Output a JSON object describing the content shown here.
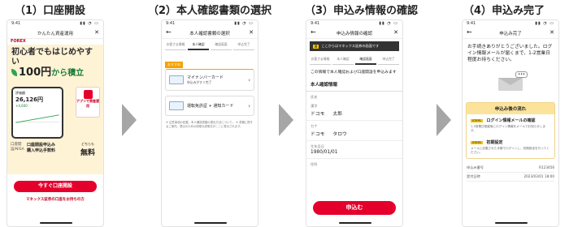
{
  "steps": [
    {
      "title": "（1）口座開設"
    },
    {
      "title": "（2）本人確認書類の選択"
    },
    {
      "title": "（3）申込み情報の確認"
    },
    {
      "title": "（4）申込み完了"
    }
  ],
  "phone1": {
    "status_time": "9:41",
    "status_icons": "▮▮ ◔ ▭",
    "nav_title": "かんたん資産運用",
    "brand": "FOREX",
    "headline1": "初心者でもはじめやすい",
    "amount": "100円",
    "headline2_suffix": "から積立",
    "mock_label": "評価額",
    "mock_amount": "26,126円",
    "mock_gain": "+4,600",
    "app_badge": "アプリで資産運用",
    "row_left": "口座開設/NISA",
    "row_mid1": "口座開設申込み",
    "row_mid2": "購入申込手数料",
    "row_right_label": "どちらも",
    "row_right_value": "無料",
    "cta": "今すぐ口座開設",
    "link": "マネックス証券の口座をお持ちの方"
  },
  "phone2": {
    "status_time": "9:41",
    "status_icons": "▮▮ ◔ ▭",
    "nav_title": "本人確認書類の選択",
    "tabs": [
      "お客さま情報",
      "本人確認",
      "確認画面",
      "申込完了"
    ],
    "rec_tag": "おすすめ",
    "option1": "マイナンバーカード",
    "option1_sub": "申込みがすぐ完了",
    "option2": "運転免許証 + 通知カード",
    "notes": "※ 注意事項の記載。本人確認書類の提出方法について。 ※ 書類に関するご案内。提出のための詳細な説明文がここに表示されます。"
  },
  "phone3": {
    "status_time": "9:41",
    "status_icons": "▮▮ ◔ ▭",
    "nav_title": "申込み情報の確認",
    "alert_mark": "X",
    "alert": "ここからはマネックス証券の画面です",
    "tabs": [
      "お客さま情報",
      "本人確認",
      "確認画面",
      "申込完了"
    ],
    "message": "この情報で本人確認および口座開設を申込みます",
    "section_title": "本人確認情報",
    "fields": [
      {
        "label": "氏名",
        "value1": "",
        "value2": ""
      },
      {
        "label": "漢字",
        "value1": "ドコモ",
        "value2": "太郎"
      },
      {
        "label": "カナ",
        "value1": "ドコモ",
        "value2": "タロウ"
      },
      {
        "label": "生年月日",
        "value1": "1980/01/01",
        "value2": ""
      },
      {
        "label": "住所",
        "value1": "",
        "value2": ""
      }
    ],
    "submit": "申込む"
  },
  "phone4": {
    "status_time": "9:41",
    "status_icons": "▮▮ ◔ ▭",
    "nav_title": "申込み完了",
    "thanks": "お手続きありがとうございました。ログイン情報メールが届くまで、1-2営業日程度お待ちください。",
    "bubble": "•••",
    "flow_title": "申込み後の流れ",
    "steps": [
      {
        "tag": "STEP1",
        "title": "ログイン情報メールの確認",
        "desc": "1-2営業日程度後にログイン情報をメールでお知らせします。"
      },
      {
        "tag": "STEP2",
        "title": "初期設定",
        "desc": "メールに記載された手順でログインし、初期設定を行ってください。"
      }
    ],
    "meta": [
      {
        "label": "申込み番号",
        "value": "R123456"
      },
      {
        "label": "受付日時",
        "value": "2023/03/01 18:00"
      }
    ]
  }
}
